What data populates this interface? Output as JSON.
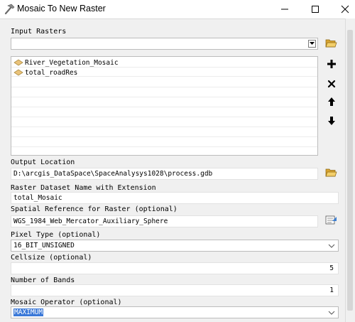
{
  "window": {
    "title": "Mosaic To New Raster"
  },
  "input_rasters": {
    "label": "Input Rasters",
    "value": "",
    "items": [
      "River_Vegetation_Mosaic",
      "total_roadRes"
    ]
  },
  "output_location": {
    "label": "Output Location",
    "value": "D:\\arcgis_DataSpace\\SpaceAnalysys1028\\process.gdb"
  },
  "raster_dataset_name": {
    "label": "Raster Dataset Name with Extension",
    "value": "total_Mosaic"
  },
  "spatial_reference": {
    "label": "Spatial Reference for Raster (optional)",
    "value": "WGS_1984_Web_Mercator_Auxiliary_Sphere"
  },
  "pixel_type": {
    "label": "Pixel Type (optional)",
    "value": "16_BIT_UNSIGNED"
  },
  "cellsize": {
    "label": "Cellsize (optional)",
    "value": "5"
  },
  "number_of_bands": {
    "label": "Number of Bands",
    "value": "1"
  },
  "mosaic_operator": {
    "label": "Mosaic Operator (optional)",
    "value": "MAXIMUM"
  },
  "icons": {
    "app": "hammer-icon",
    "browse": "folder-open-icon",
    "add": "plus-icon",
    "remove": "x-icon",
    "up": "arrow-up-icon",
    "down": "arrow-down-icon",
    "spatial_ref": "spatial-reference-icon"
  },
  "colors": {
    "selection": "#3a78d8",
    "folder": "#e8b84a",
    "raster_icon": "#e9c27a"
  }
}
